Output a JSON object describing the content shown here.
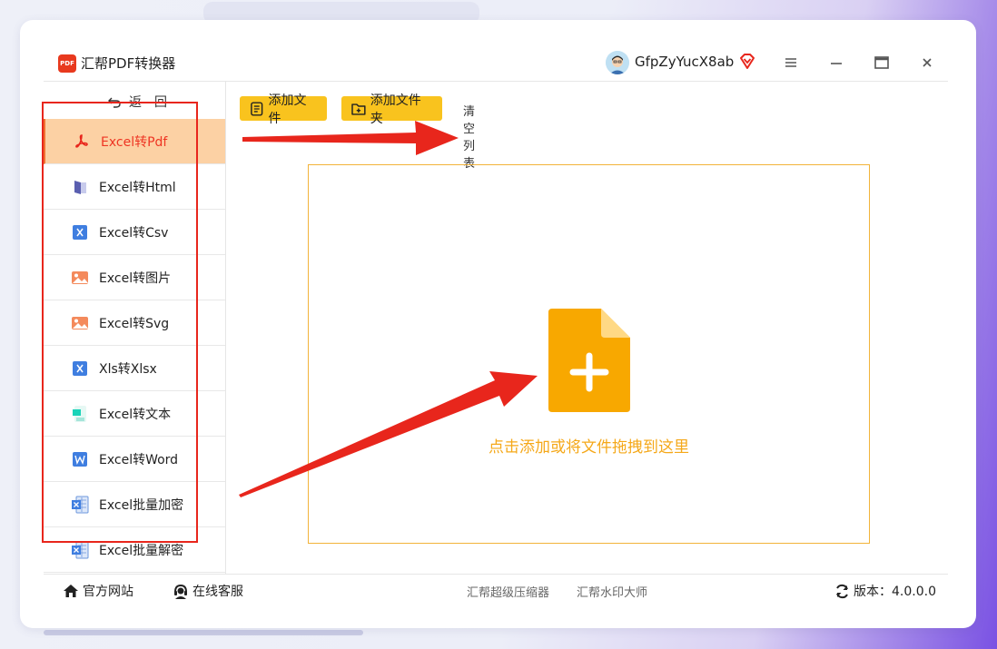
{
  "app": {
    "title": "汇帮PDF转换器",
    "logo_text": "PDF"
  },
  "user": {
    "name": "GfpZyYucX8ab"
  },
  "sidebar": {
    "back_label": "返　回",
    "items": [
      {
        "label": "Excel转Pdf",
        "icon": "pdf-icon",
        "active": true
      },
      {
        "label": "Excel转Html",
        "icon": "html-file-icon",
        "active": false
      },
      {
        "label": "Excel转Csv",
        "icon": "csv-icon",
        "active": false
      },
      {
        "label": "Excel转图片",
        "icon": "image-icon",
        "active": false
      },
      {
        "label": "Excel转Svg",
        "icon": "svg-image-icon",
        "active": false
      },
      {
        "label": "Xls转Xlsx",
        "icon": "xlsx-icon",
        "active": false
      },
      {
        "label": "Excel转文本",
        "icon": "text-file-icon",
        "active": false
      },
      {
        "label": "Excel转Word",
        "icon": "word-icon",
        "active": false
      },
      {
        "label": "Excel批量加密",
        "icon": "excel-lock-icon",
        "active": false
      },
      {
        "label": "Excel批量解密",
        "icon": "excel-unlock-icon",
        "active": false
      }
    ]
  },
  "toolbar": {
    "add_file": "添加文件",
    "add_folder": "添加文件夹",
    "clear_list": "清空列表"
  },
  "dropzone": {
    "text": "点击添加或将文件拖拽到这里"
  },
  "footer": {
    "website": "官方网站",
    "support": "在线客服",
    "link1": "汇帮超级压缩器",
    "link2": "汇帮水印大师",
    "version": "版本：4.0.0.0"
  },
  "colors": {
    "accent": "#f9c31e",
    "active_bg": "#fcd1a4",
    "active_text": "#ee3523",
    "drop_text": "#f5a819",
    "annotation_red": "#e8261c"
  }
}
